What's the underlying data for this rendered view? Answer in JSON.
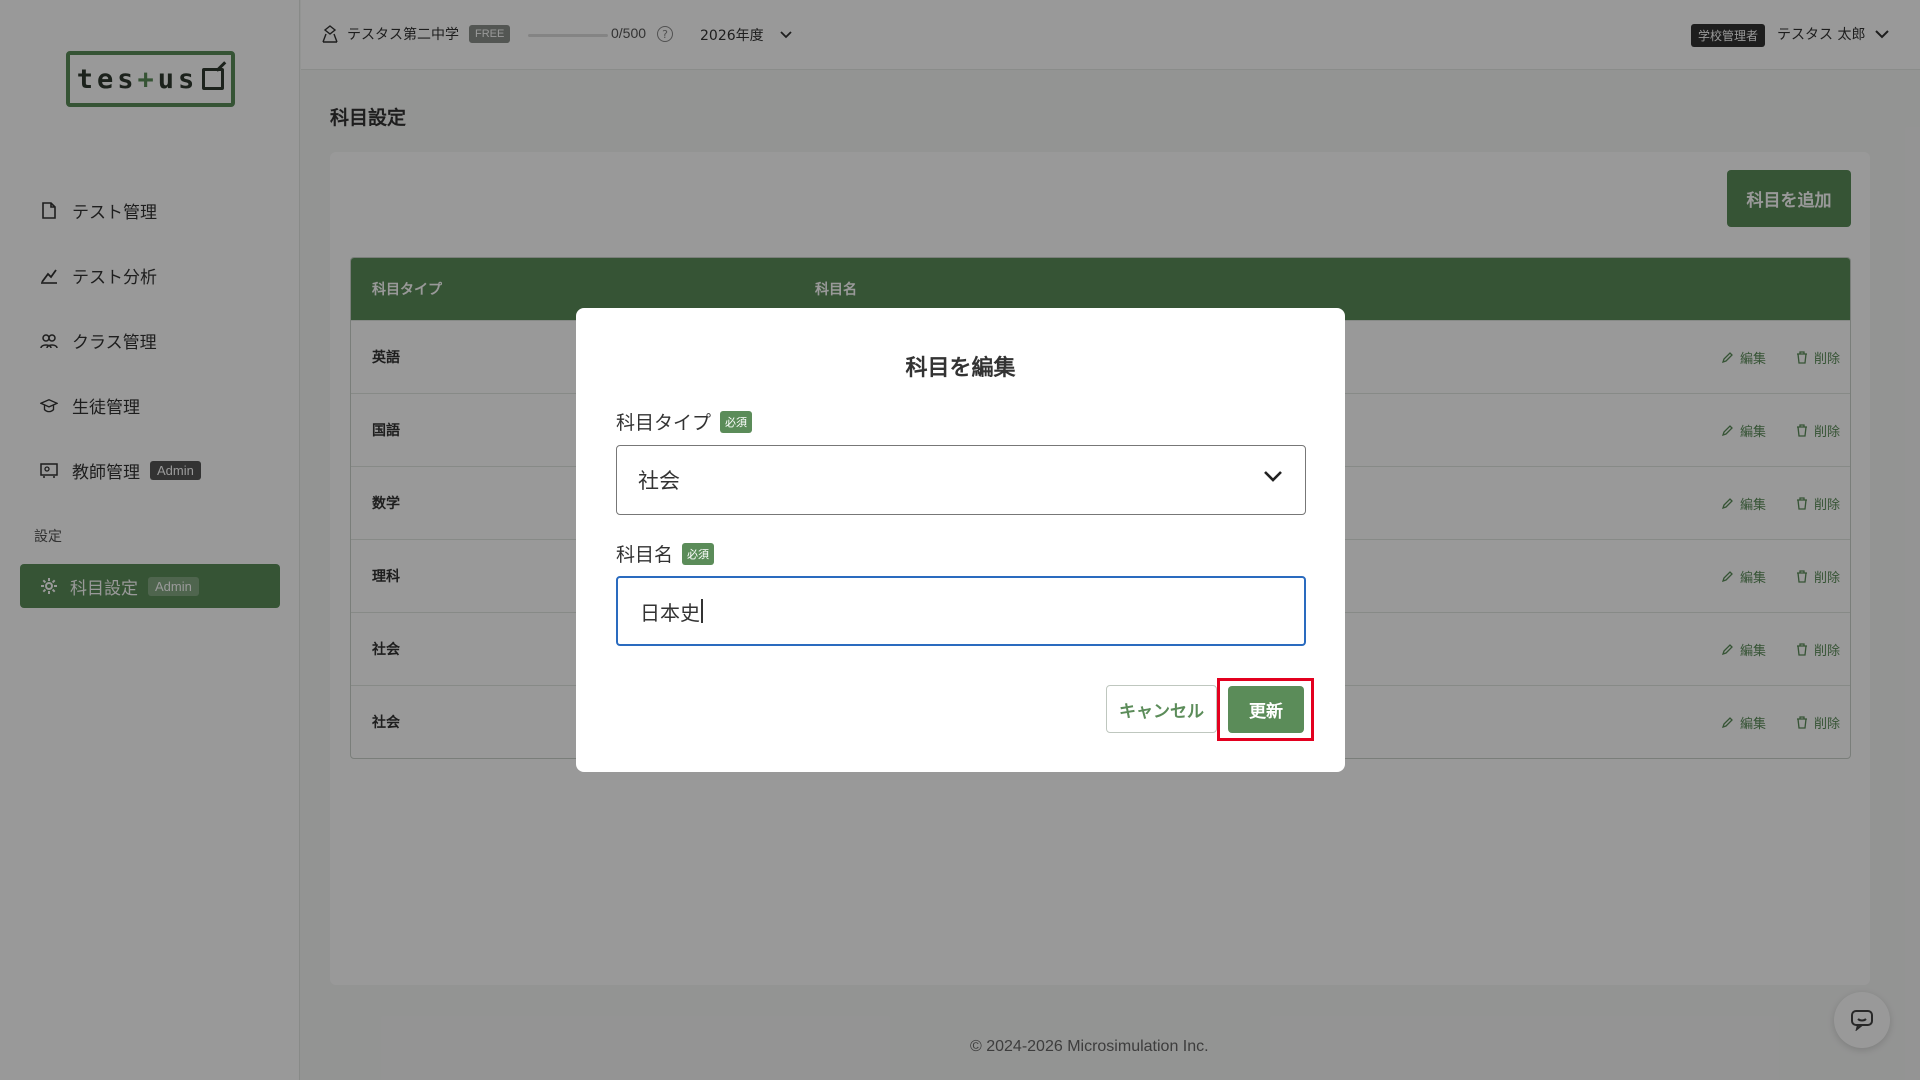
{
  "sidebar": {
    "logo_text": "tes+us",
    "items": [
      {
        "label": "テスト管理",
        "icon": "document-icon"
      },
      {
        "label": "テスト分析",
        "icon": "analysis-icon"
      },
      {
        "label": "クラス管理",
        "icon": "group-icon"
      },
      {
        "label": "生徒管理",
        "icon": "graduation-cap-icon"
      },
      {
        "label": "教師管理",
        "icon": "teacher-board-icon",
        "badge": "Admin"
      }
    ],
    "section_label": "設定",
    "active_item": {
      "label": "科目設定",
      "icon": "gear-icon",
      "badge": "Admin"
    }
  },
  "header": {
    "school_name": "テスタス第二中学",
    "plan_badge": "FREE",
    "usage_text": "0/500",
    "usage_fraction": 0,
    "help_symbol": "?",
    "year": "2026年度",
    "role_badge": "学校管理者",
    "user_name": "テスタス 太郎"
  },
  "main": {
    "page_title": "科目設定",
    "add_button": "科目を追加",
    "table": {
      "columns": [
        "科目タイプ",
        "科目名"
      ],
      "rows": [
        {
          "type": "英語"
        },
        {
          "type": "国語"
        },
        {
          "type": "数学"
        },
        {
          "type": "理科"
        },
        {
          "type": "社会"
        },
        {
          "type": "社会"
        }
      ],
      "edit_label": "編集",
      "delete_label": "削除"
    }
  },
  "footer": {
    "copyright": "© 2024-2026 Microsimulation Inc."
  },
  "modal": {
    "title": "科目を編集",
    "type_label": "科目タイプ",
    "required_badge": "必須",
    "type_value": "社会",
    "name_label": "科目名",
    "name_value": "日本史",
    "cancel_button": "キャンセル",
    "update_button": "更新"
  },
  "colors": {
    "accent": "#5b8c59",
    "highlight": "#e3001f",
    "focus": "#2a6bbf"
  }
}
